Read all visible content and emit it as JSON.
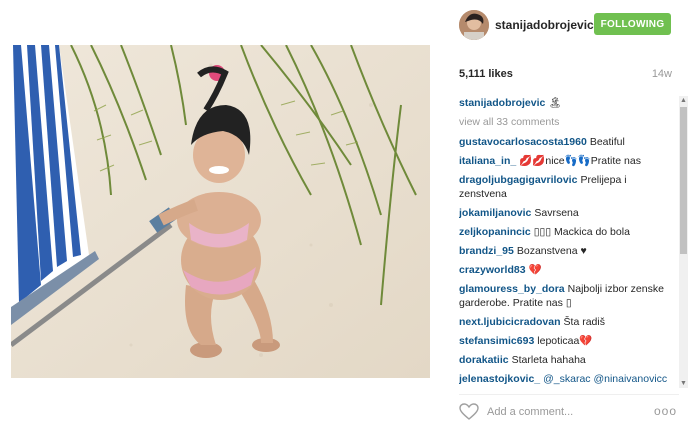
{
  "post": {
    "username": "stanijadobrojevic",
    "follow_label": "FOLLOWING",
    "likes": "5,111 likes",
    "time_ago": "14w"
  },
  "caption": {
    "username": "stanijadobrojevic",
    "text": "🏝"
  },
  "view_all": "view all 33 comments",
  "comments": [
    {
      "user": "gustavocarlosacosta1960",
      "text": "Beatiful"
    },
    {
      "user": "italiana_in_",
      "text": "💋💋nice👣👣Pratite nas"
    },
    {
      "user": "dragoljubgagigavrilovic",
      "text": "Prelijepa i zenstvena"
    },
    {
      "user": "jokamiljanovic",
      "text": "Savrsena"
    },
    {
      "user": "zeljkopanincic",
      "text": "▯▯▯ Mackica do bola"
    },
    {
      "user": "brandzi_95",
      "text": "Bozanstvena ♥"
    },
    {
      "user": "crazyworld83",
      "text": "💔"
    },
    {
      "user": "glamouress_by_dora",
      "text": "Najbolji izbor zenske garderobe. Pratite nas ▯"
    },
    {
      "user": "next.ljubicicradovan",
      "text": "Šta radiš"
    },
    {
      "user": "stefansimic693",
      "text": "lepoticaa💔"
    },
    {
      "user": "dorakatiic",
      "text": "Starleta hahaha"
    },
    {
      "user": "jelenastojkovic_",
      "text": "@_skarac @ninaivanovicc"
    }
  ],
  "add_comment_placeholder": "Add a comment...",
  "more_label": "ooo",
  "icons": {
    "heart": "heart-icon",
    "more": "more-options-icon",
    "scroll_up": "arrow-up-icon",
    "scroll_down": "arrow-down-icon"
  },
  "colors": {
    "follow_bg": "#70c050",
    "username": "#125688",
    "muted": "#999999"
  }
}
